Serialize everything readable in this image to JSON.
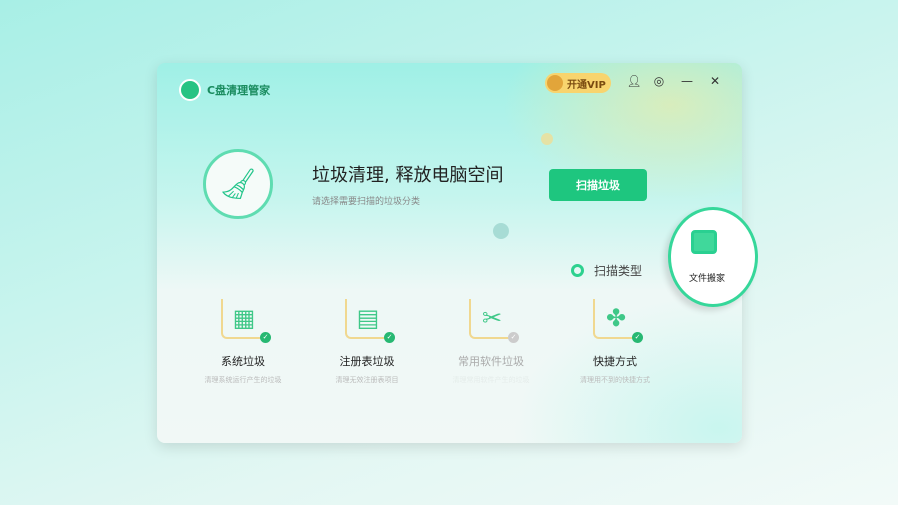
{
  "app": {
    "title": "C盘清理管家"
  },
  "titlebar": {
    "vip_label": "开通VIP"
  },
  "hero": {
    "title": "垃圾清理, 释放电脑空间",
    "subtitle": "请选择需要扫描的垃圾分类",
    "scan_button": "扫描垃圾"
  },
  "scan_type_label": "扫描类型",
  "items": [
    {
      "name": "系统垃圾",
      "desc": "清理系统运行产生的垃圾",
      "icon": "▦",
      "checked": true
    },
    {
      "name": "注册表垃圾",
      "desc": "清理无效注册表项目",
      "icon": "▤",
      "checked": true
    },
    {
      "name": "常用软件垃圾",
      "desc": "清理常用软件产生的垃圾",
      "icon": "✂",
      "checked": false
    },
    {
      "name": "快捷方式",
      "desc": "清理用不到的快捷方式",
      "icon": "✤",
      "checked": true
    }
  ],
  "file_mover": {
    "label": "文件搬家"
  }
}
